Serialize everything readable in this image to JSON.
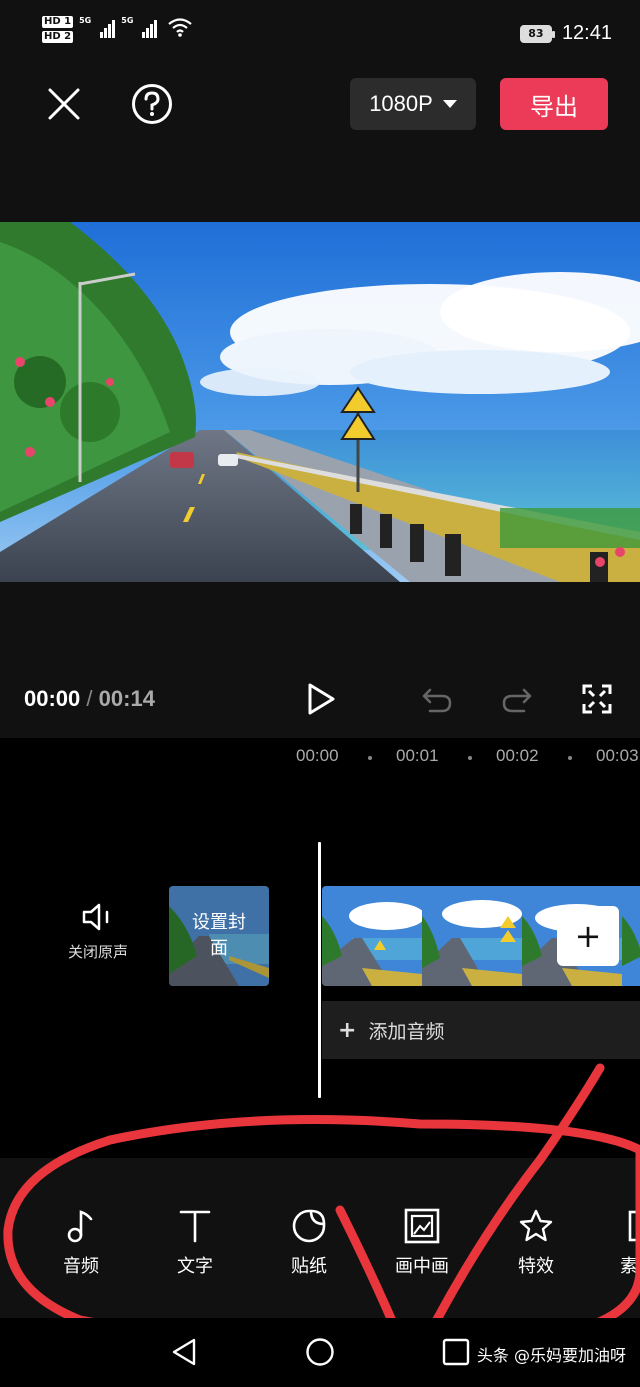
{
  "status_bar": {
    "sim1_tag": "HD 1",
    "sim2_tag": "HD 2",
    "network_1": "5G",
    "network_2": "5G",
    "battery": "83",
    "time": "12:41"
  },
  "top_bar": {
    "close_icon": "close-icon",
    "help_icon": "help-icon",
    "resolution": "1080P",
    "export_label": "导出"
  },
  "player": {
    "current_time": "00:00",
    "separator": "/",
    "total_time": "00:14"
  },
  "ruler": {
    "ticks": [
      "00:00",
      "00:01",
      "00:02",
      "00:03"
    ]
  },
  "timeline": {
    "mute_label": "关闭原声",
    "cover_label": "设置封面",
    "add_audio_plus": "+",
    "add_audio_label": "添加音频",
    "add_clip_plus": "+"
  },
  "toolbar": {
    "items": [
      {
        "label": "音频",
        "icon": "music-note-icon"
      },
      {
        "label": "文字",
        "icon": "text-icon"
      },
      {
        "label": "贴纸",
        "icon": "sticker-icon"
      },
      {
        "label": "画中画",
        "icon": "picture-in-picture-icon"
      },
      {
        "label": "特效",
        "icon": "effects-star-icon"
      },
      {
        "label": "素",
        "icon": "material-icon"
      }
    ]
  },
  "watermark": "头条 @乐妈要加油呀",
  "colors": {
    "accent": "#ec3b58",
    "annotation": "#e8363c",
    "panel": "#111111"
  }
}
